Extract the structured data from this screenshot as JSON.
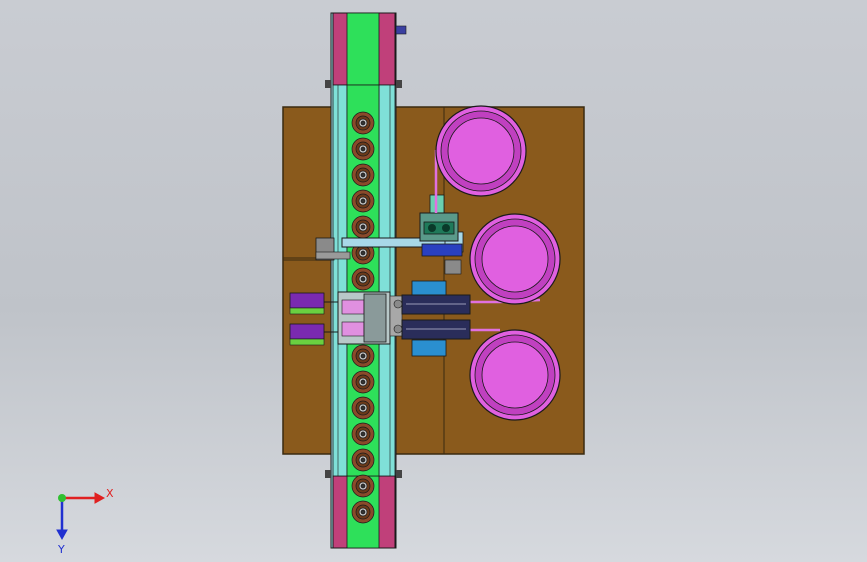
{
  "viewport": {
    "description_free": true,
    "colors": {
      "background": "#c8cbd1",
      "base_plate": "#8a5a1c",
      "base_plate_edge": "#3a2a10",
      "conveyor_belt": "#2ee05a",
      "conveyor_rail": "#7fe0d8",
      "conveyor_end_cap": "#c0407a",
      "roller": "#8a4a2a",
      "tray": "#e060e0",
      "tray_rim": "#c040c0",
      "cylinder_dark": "#2a2d5a",
      "block_blue": "#2a8fd0",
      "clamp_purple": "#7a2ab0",
      "clamp_green": "#6ad040",
      "pink_tube": "#e070e0",
      "outline": "#1a1a1a"
    },
    "roller_count_top": 7,
    "roller_count_bottom": 7,
    "tray_count": 3
  },
  "triad": {
    "x_label": "X",
    "y_label": "Y",
    "colors": {
      "x": "#e02020",
      "y": "#2030d0",
      "origin": "#30c030"
    }
  }
}
